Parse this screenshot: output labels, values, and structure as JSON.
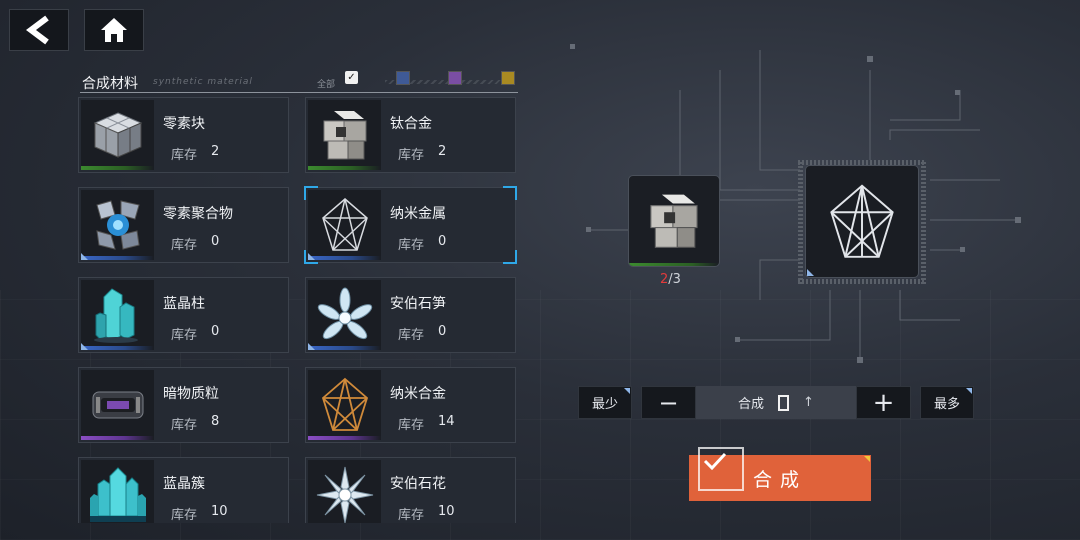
{
  "nav": {
    "back_icon": "back-arrow-icon",
    "home_icon": "home-icon"
  },
  "panel": {
    "title": "合成材料",
    "subtitle": "synthetic material",
    "filter_all_label": "全部",
    "filter_colors": {
      "blue": "#3f5a96",
      "purple": "#7a4ea3",
      "gold": "#a98a22"
    }
  },
  "materials": [
    {
      "name": "零素块",
      "stock_label": "库存",
      "count": "2",
      "rarity": "green",
      "icon": "silver-cube-icon"
    },
    {
      "name": "钛合金",
      "stock_label": "库存",
      "count": "2",
      "rarity": "green",
      "icon": "titanium-alloy-icon"
    },
    {
      "name": "零素聚合物",
      "stock_label": "库存",
      "count": "0",
      "rarity": "blue",
      "icon": "polymer-icon"
    },
    {
      "name": "纳米金属",
      "stock_label": "库存",
      "count": "0",
      "rarity": "blue",
      "icon": "nano-metal-icon",
      "selected": true
    },
    {
      "name": "蓝晶柱",
      "stock_label": "库存",
      "count": "0",
      "rarity": "blue",
      "icon": "blue-crystal-pillar-icon"
    },
    {
      "name": "安伯石笋",
      "stock_label": "库存",
      "count": "0",
      "rarity": "blue",
      "icon": "amber-stalagmite-icon"
    },
    {
      "name": "暗物质粒",
      "stock_label": "库存",
      "count": "8",
      "rarity": "purple",
      "icon": "dark-matter-icon"
    },
    {
      "name": "纳米合金",
      "stock_label": "库存",
      "count": "14",
      "rarity": "purple",
      "icon": "nano-alloy-icon"
    },
    {
      "name": "蓝晶簇",
      "stock_label": "库存",
      "count": "10",
      "rarity": "purple",
      "icon": "blue-crystal-cluster-icon"
    },
    {
      "name": "安伯石花",
      "stock_label": "库存",
      "count": "10",
      "rarity": "purple",
      "icon": "amber-flower-icon"
    }
  ],
  "synthesis": {
    "source_have": "2",
    "source_need": "/3",
    "min_label": "最少",
    "max_label": "最多",
    "minus_label": "−",
    "plus_label": "+",
    "qty_label": "合成",
    "qty_arrow": "↑",
    "craft_label": "合成",
    "colors": {
      "craft": "#e0623a",
      "have_shortage": "#e23b3b"
    }
  }
}
